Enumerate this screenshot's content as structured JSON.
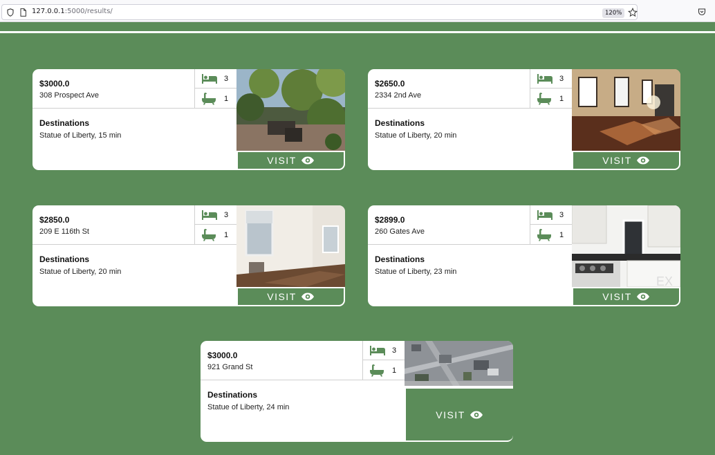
{
  "browser": {
    "url_host": "127.0.0.1",
    "url_rest": ":5000/results/",
    "zoom": "120%"
  },
  "theme": {
    "green": "#5b8c59"
  },
  "visit_label": "VISIT",
  "destinations_title": "Destinations",
  "listings": [
    {
      "price": "$3000.0",
      "address": "308 Prospect Ave",
      "beds": "3",
      "baths": "1",
      "destination": "Statue of Liberty, 15 min",
      "photo": "garden-patio"
    },
    {
      "price": "$2650.0",
      "address": "2334 2nd Ave",
      "beds": "3",
      "baths": "1",
      "destination": "Statue of Liberty, 20 min",
      "photo": "living-room-wood-floor"
    },
    {
      "price": "$2850.0",
      "address": "209 E 116th St",
      "beds": "3",
      "baths": "1",
      "destination": "Statue of Liberty, 20 min",
      "photo": "empty-room-radiator"
    },
    {
      "price": "$2899.0",
      "address": "260 Gates Ave",
      "beds": "3",
      "baths": "1",
      "destination": "Statue of Liberty, 23 min",
      "photo": "kitchen"
    },
    {
      "price": "$3000.0",
      "address": "921 Grand St",
      "beds": "3",
      "baths": "1",
      "destination": "Statue of Liberty, 24 min",
      "photo": "aerial-map"
    }
  ]
}
